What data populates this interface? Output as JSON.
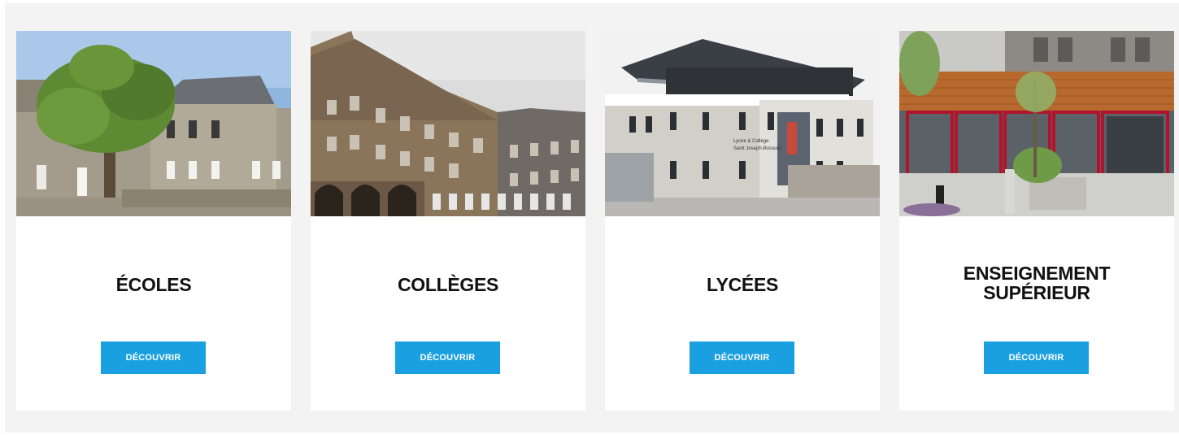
{
  "cards": [
    {
      "title_lines": [
        "ÉCOLES"
      ],
      "button_label": "DÉCOUVRIR"
    },
    {
      "title_lines": [
        "COLLÈGES"
      ],
      "button_label": "DÉCOUVRIR"
    },
    {
      "title_lines": [
        "LYCÉES"
      ],
      "button_label": "DÉCOUVRIR",
      "photo_sign": [
        "Lycée & Collège",
        "Saint Joseph-Bossuet"
      ]
    },
    {
      "title_lines": [
        "ENSEIGNEMENT",
        "SUPÉRIEUR"
      ],
      "button_label": "DÉCOUVRIR"
    }
  ],
  "colors": {
    "panel_background": "#f3f3f3",
    "card_background": "#ffffff",
    "button_background": "#1aa0e0",
    "button_text": "#ffffff",
    "title_text": "#111111"
  }
}
